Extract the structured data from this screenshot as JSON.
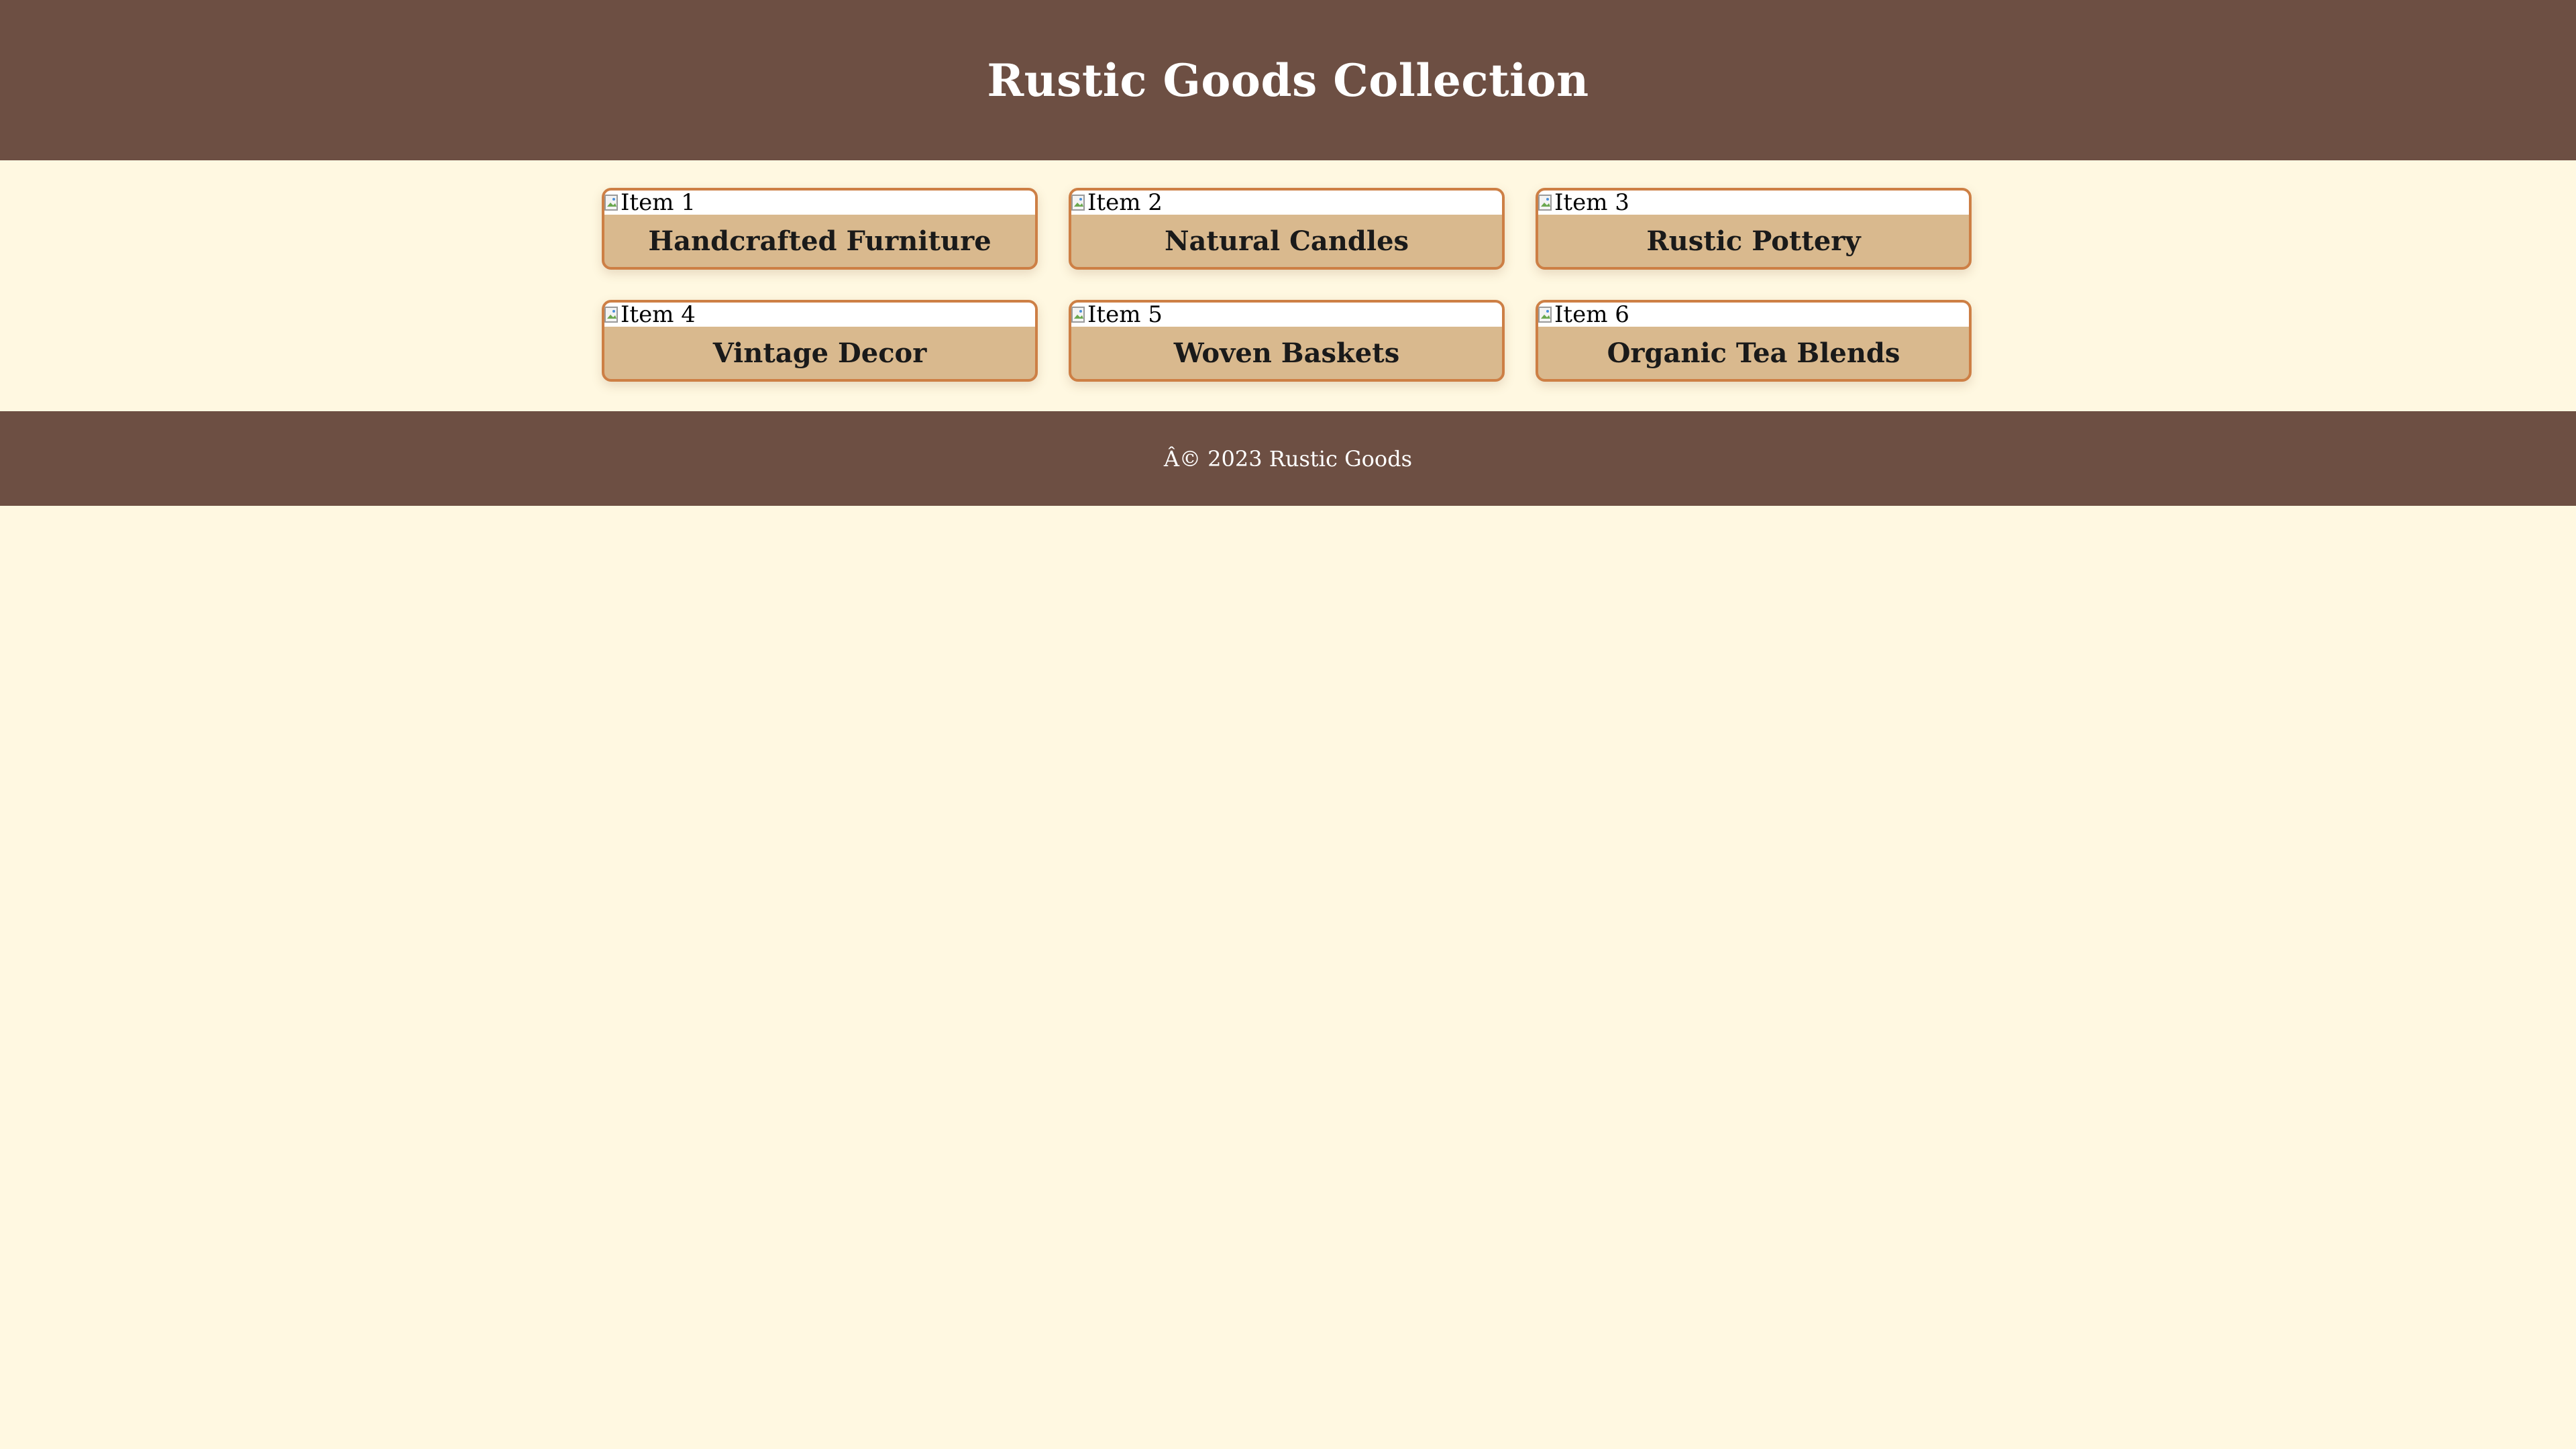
{
  "header": {
    "title": "Rustic Goods Collection"
  },
  "items": [
    {
      "image_alt": "Item 1",
      "title": "Handcrafted Furniture"
    },
    {
      "image_alt": "Item 2",
      "title": "Natural Candles"
    },
    {
      "image_alt": "Item 3",
      "title": "Rustic Pottery"
    },
    {
      "image_alt": "Item 4",
      "title": "Vintage Decor"
    },
    {
      "image_alt": "Item 5",
      "title": "Woven Baskets"
    },
    {
      "image_alt": "Item 6",
      "title": "Organic Tea Blends"
    }
  ],
  "footer": {
    "copyright": "Â© 2023 Rustic Goods"
  },
  "colors": {
    "header_bg": "#6d4f43",
    "page_bg": "#fff8e1",
    "card_bg": "#d9b98e",
    "card_border": "#cd7f45"
  },
  "icons": {
    "broken_image": "broken-image-icon"
  }
}
